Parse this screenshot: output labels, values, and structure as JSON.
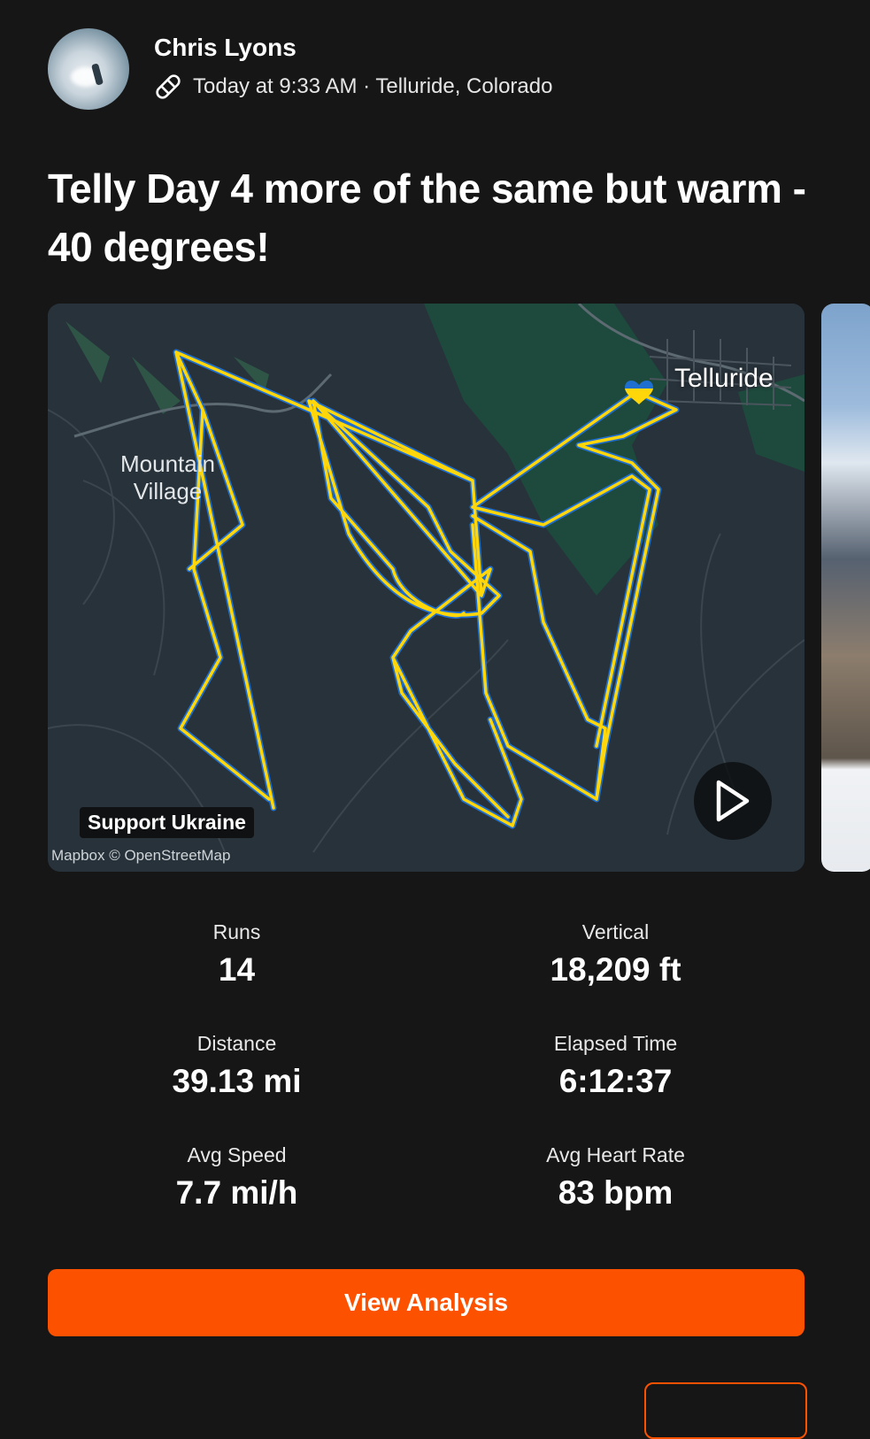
{
  "header": {
    "athlete_name": "Chris Lyons",
    "sport_icon": "snowboard-icon",
    "meta": "Today at 9:33 AM · Telluride, Colorado"
  },
  "activity_title": "Telly Day 4 more of the same but warm - 40 degrees!",
  "map": {
    "labels": {
      "mountain_village": "Mountain\nVillage",
      "town": "Telluride"
    },
    "badge": "Support Ukraine",
    "attribution": "Mapbox © OpenStreetMap",
    "route_color_fill": "#ffd60a",
    "route_color_outline": "#1f6fd1",
    "play_icon": "play-icon"
  },
  "stats": [
    {
      "label": "Runs",
      "value": "14"
    },
    {
      "label": "Vertical",
      "value": "18,209 ft"
    },
    {
      "label": "Distance",
      "value": "39.13 mi"
    },
    {
      "label": "Elapsed Time",
      "value": "6:12:37"
    },
    {
      "label": "Avg Speed",
      "value": "7.7 mi/h"
    },
    {
      "label": "Avg Heart Rate",
      "value": "83 bpm"
    }
  ],
  "cta": {
    "label": "View Analysis",
    "color": "#fc5200"
  }
}
